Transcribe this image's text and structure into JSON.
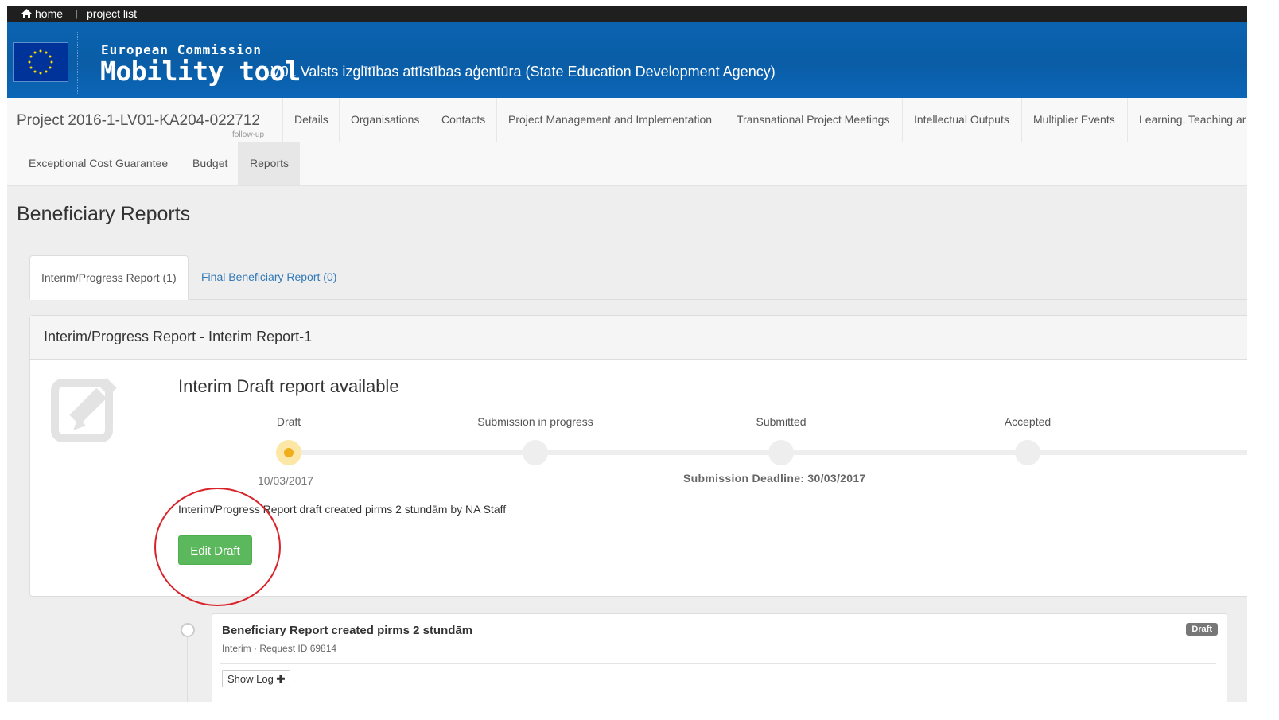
{
  "topbar": {
    "home_label": "home",
    "separator": "|",
    "project_list_label": "project list"
  },
  "header": {
    "org_line": "European Commission",
    "app_name": "Mobility tool",
    "agency": "LV01 Valsts izglītības attīstības aģentūra (State Education Development Agency)"
  },
  "project": {
    "title": "Project 2016-1-LV01-KA204-022712",
    "subtitle": "follow-up"
  },
  "nav": {
    "row1": [
      "Details",
      "Organisations",
      "Contacts",
      "Project Management and Implementation",
      "Transnational Project Meetings",
      "Intellectual Outputs",
      "Multiplier Events",
      "Learning, Teaching ar"
    ],
    "row2": [
      "Exceptional Cost Guarantee",
      "Budget",
      "Reports"
    ],
    "active": "Reports"
  },
  "page": {
    "title": "Beneficiary Reports"
  },
  "tabs": {
    "interim": "Interim/Progress Report (1)",
    "final": "Final Beneficiary Report (0)"
  },
  "panel": {
    "heading": "Interim/Progress Report - Interim Report-1",
    "status_title": "Interim Draft report available",
    "steps": [
      "Draft",
      "Submission in progress",
      "Submitted",
      "Accepted"
    ],
    "current_step": "Draft",
    "draft_date": "10/03/2017",
    "deadline": "Submission Deadline: 30/03/2017",
    "created_text": "Interim/Progress Report draft created pirms 2 stundām by NA Staff",
    "edit_button": "Edit Draft"
  },
  "timeline": {
    "title": "Beneficiary Report created pirms 2 stundām",
    "subtitle": "Interim · Request ID 69814",
    "badge": "Draft",
    "show_log": "Show Log"
  },
  "colors": {
    "header_blue": "#0b63b0",
    "success_green": "#5cb85c",
    "link_blue": "#337ab7",
    "current_step": "#f0ad1c",
    "annotation_red": "#d9232a"
  }
}
